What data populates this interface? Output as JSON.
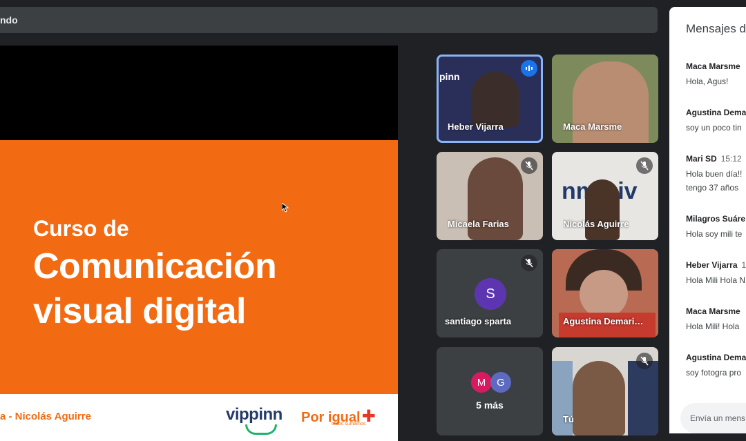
{
  "topbar": {
    "text": "ndo"
  },
  "slide": {
    "line1": "Curso de",
    "line2": "Comunicación",
    "line3": "visual digital",
    "footer": "a - Nicolás Aguirre",
    "logo_vippinn": "vippinn",
    "logo_porigual": "Por igual",
    "logo_porigual_sub": "todos sumamos"
  },
  "participants": [
    {
      "name": "Heber Vijarra",
      "status": "speaking"
    },
    {
      "name": "Maca Marsme",
      "status": ""
    },
    {
      "name": "Micaela Farias",
      "status": "muted"
    },
    {
      "name": "Nicolás Aguirre",
      "status": "muted"
    },
    {
      "name": "santiago sparta",
      "status": "muted",
      "initial": "S"
    },
    {
      "name": "Agustina Demari…",
      "status": ""
    },
    {
      "name": "5 más",
      "initials": [
        "M",
        "G"
      ]
    },
    {
      "name": "Tú",
      "status": "muted"
    }
  ],
  "tile_brand": {
    "pinn": "pinn",
    "nmqiv": "nm qiv"
  },
  "chat": {
    "title": "Mensajes d",
    "messages": [
      {
        "sender": "Maca Marsme",
        "time": "",
        "lines": [
          "Hola, Agus!"
        ]
      },
      {
        "sender": "Agustina Dema",
        "time": "",
        "lines": [
          "soy un poco tin"
        ]
      },
      {
        "sender": "Mari SD",
        "time": "15:12",
        "lines": [
          "Hola buen día!!",
          "tengo 37 años"
        ]
      },
      {
        "sender": "Milagros Suáre",
        "time": "",
        "lines": [
          "Hola soy mili te"
        ]
      },
      {
        "sender": "Heber Vijarra",
        "time": "1",
        "lines": [
          "Hola Mili Hola N"
        ]
      },
      {
        "sender": "Maca Marsme",
        "time": "",
        "lines": [
          "Hola  Mili! Hola"
        ]
      },
      {
        "sender": "Agustina Dema",
        "time": "",
        "lines": [
          "soy fotogra pro"
        ]
      }
    ],
    "input_placeholder": "Envía un mens"
  },
  "colors": {
    "accent": "#1a73e8",
    "slide_orange": "#f26b12",
    "bg": "#202124"
  }
}
